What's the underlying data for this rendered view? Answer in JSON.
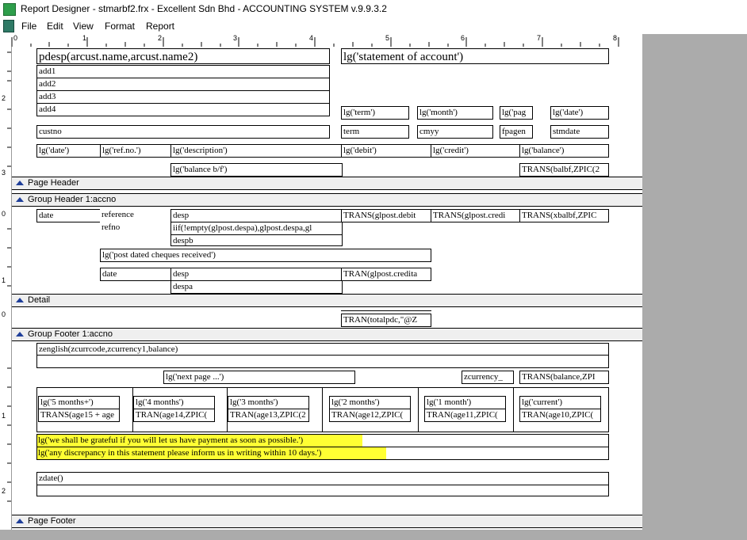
{
  "window": {
    "title": "Report Designer - stmarbf2.frx - Excellent Sdn Bhd - ACCOUNTING SYSTEM v.9.9.3.2"
  },
  "menu": [
    "File",
    "Edit",
    "View",
    "Format",
    "Report"
  ],
  "ruler": {
    "top": [
      "0",
      "1",
      "2",
      "3",
      "4",
      "5",
      "6",
      "7",
      "8"
    ],
    "left": [
      "2",
      "3",
      "0",
      "1",
      "0",
      "1",
      "2"
    ]
  },
  "bands": {
    "page_header": "Page Header",
    "group_header": "Group Header 1:accno",
    "detail": "Detail",
    "group_footer": "Group Footer 1:accno",
    "page_footer": "Page Footer"
  },
  "page_header": {
    "desp": "pdesp(arcust.name,arcust.name2)",
    "title": "lg('statement of account')",
    "add1": "add1",
    "add2": "add2",
    "add3": "add3",
    "add4": "add4",
    "lg_term": "lg('term')",
    "lg_month": "lg('month')",
    "lg_page": "lg('pag",
    "lg_date_top": "lg('date')",
    "custno": "custno",
    "term": "term",
    "cmyy": "cmyy",
    "fpagen": "fpagen",
    "stmdate": "stmdate",
    "col_date": "lg('date')",
    "col_refno": "lg('ref.no.')",
    "col_desc": "lg('description')",
    "col_debit": "lg('debit')",
    "col_credit": "lg('credit')",
    "col_balance": "lg('balance')",
    "balance_bf": "lg('balance b/f')",
    "trans_balbf": "TRANS(balbf,ZPIC(2"
  },
  "group_header": {
    "date": "date",
    "reference": "reference",
    "desp": "desp",
    "trans_debit": "TRANS(glpost.debit",
    "trans_credit": "TRANS(glpost.credi",
    "trans_xbalbf": "TRANS(xbalbf,ZPIC",
    "refno": "refno",
    "iif": "iif(!empty(glpost.despa),glpost.despa,gl",
    "despb": "despb",
    "pdc_title": "lg('post dated cheques received')",
    "pdc_date": "date",
    "pdc_desp": "desp",
    "pdc_tran": "TRAN(glpost.credita",
    "pdc_despa": "despa"
  },
  "detail": {
    "total_pdc": "TRAN(totalpdc,\"@Z"
  },
  "group_footer": {
    "zenglish": "zenglish(zcurrcode,zcurrency1,balance)",
    "next_page": "lg('next page ...')",
    "zcurrency": "zcurrency_",
    "trans_balance": "TRANS(balance,ZPI",
    "aging": [
      {
        "label": "lg('5 months+')",
        "value": "TRANS(age15 + age"
      },
      {
        "label": "lg('4 months')",
        "value": "TRAN(age14,ZPIC("
      },
      {
        "label": "lg('3 months')",
        "value": "TRAN(age13,ZPIC(2"
      },
      {
        "label": "lg('2 months')",
        "value": "TRAN(age12,ZPIC("
      },
      {
        "label": "lg('1 month')",
        "value": "TRAN(age11,ZPIC("
      },
      {
        "label": "lg('current')",
        "value": "TRAN(age10,ZPIC("
      }
    ],
    "note1": "lg('we shall be grateful if you will let us have payment as soon as possible.')",
    "note2": "lg('any discrepancy in this statement please inform us in writing within 10 days.')",
    "zdate": "zdate()"
  },
  "colors": {
    "highlight": "#ffff33",
    "band": "#efefef",
    "workspace": "#ababab",
    "band_arrow": "#1f3f9a"
  }
}
